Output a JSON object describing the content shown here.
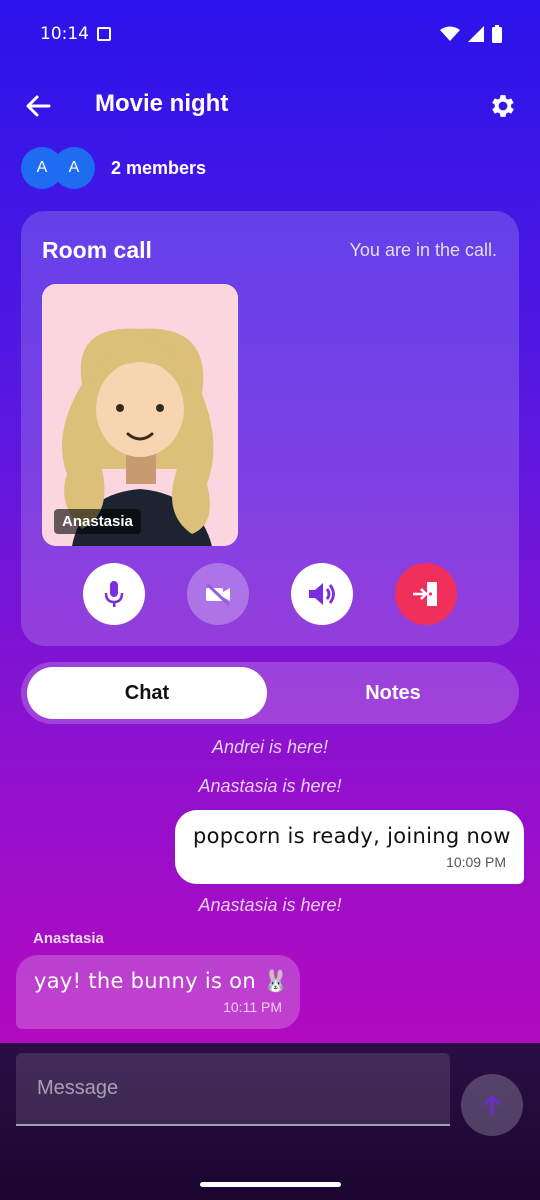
{
  "status_bar": {
    "time": "10:14"
  },
  "header": {
    "title": "Movie night"
  },
  "members": {
    "avatars": [
      "A",
      "A"
    ],
    "label": "2 members"
  },
  "call": {
    "title": "Room call",
    "status": "You are in the call.",
    "participant_name": "Anastasia",
    "controls": [
      "mic-icon",
      "video-off-icon",
      "speaker-icon",
      "leave-icon"
    ]
  },
  "tabs": {
    "chat": "Chat",
    "notes": "Notes",
    "selected": "Chat"
  },
  "messages": {
    "sys1": "Andrei is here!",
    "sys2": "Anastasia is here!",
    "out1_text": "popcorn is ready, joining now",
    "out1_time": "10:09 PM",
    "sys3": "Anastasia is here!",
    "in1_sender": "Anastasia",
    "in1_text": "yay! the bunny is on 🐰",
    "in1_time": "10:11 PM"
  },
  "composer": {
    "placeholder": "Message"
  },
  "colors": {
    "accent": "#7a2ee0",
    "leave": "#f0305a",
    "avatar": "#1e6cf0"
  }
}
